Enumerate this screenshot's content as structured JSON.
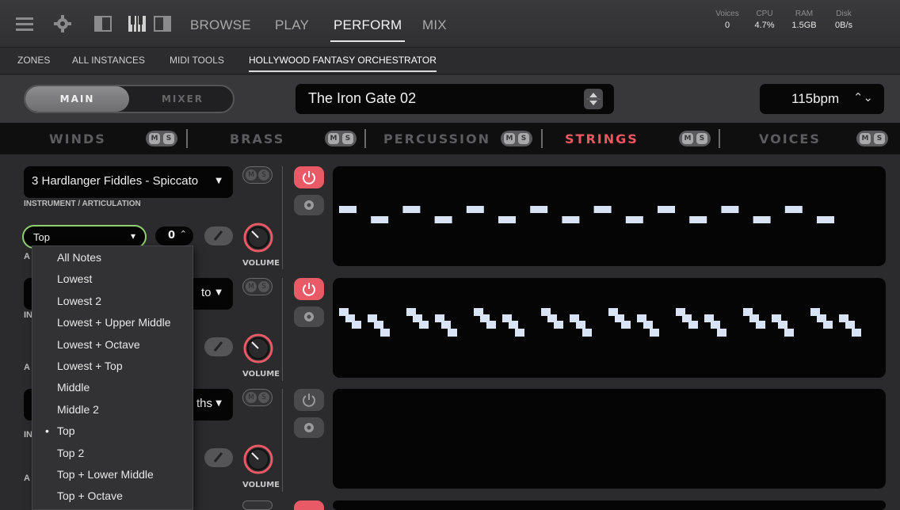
{
  "topbar": {
    "tabs": [
      {
        "label": "BROWSE",
        "active": false
      },
      {
        "label": "PLAY",
        "active": false
      },
      {
        "label": "PERFORM",
        "active": true
      },
      {
        "label": "MIX",
        "active": false
      }
    ],
    "icons": [
      "menu-icon",
      "gear-icon",
      "left-panel-icon",
      "keyboard-icon",
      "right-panel-icon"
    ],
    "stats": [
      {
        "label": "Voices",
        "value": "0"
      },
      {
        "label": "CPU",
        "value": "4.7%"
      },
      {
        "label": "RAM",
        "value": "1.5GB"
      },
      {
        "label": "Disk",
        "value": "0B/s"
      }
    ]
  },
  "subtabs": [
    {
      "label": "ZONES",
      "active": false
    },
    {
      "label": "ALL INSTANCES",
      "active": false
    },
    {
      "label": "MIDI TOOLS",
      "active": false
    },
    {
      "label": "HOLLYWOOD FANTASY ORCHESTRATOR",
      "active": true
    }
  ],
  "mode": {
    "main": "MAIN",
    "mixer": "MIXER",
    "selected": "MAIN"
  },
  "preset": {
    "name": "The Iron Gate 02"
  },
  "tempo": {
    "value": "115bpm"
  },
  "sections": [
    {
      "label": "WINDS",
      "active": false,
      "m": "M",
      "s": "S"
    },
    {
      "label": "BRASS",
      "active": false,
      "m": "M",
      "s": "S"
    },
    {
      "label": "PERCUSSION",
      "active": false,
      "m": "M",
      "s": "S"
    },
    {
      "label": "STRINGS",
      "active": true,
      "m": "M",
      "s": "S"
    },
    {
      "label": "VOICES",
      "active": false,
      "m": "M",
      "s": "S"
    }
  ],
  "rows": [
    {
      "instrument": "3 Hardlanger Fiddles - Spiccato",
      "instrument_label": "INSTRUMENT / ARTICULATION",
      "arp_value": "0",
      "volume_label": "VOLUME",
      "power": "on"
    },
    {
      "instrument_partial": "to",
      "arp_prefix": "A",
      "inst_prefix": "IN",
      "volume_label": "VOLUME",
      "power": "on"
    },
    {
      "instrument_partial": "ths",
      "arp_prefix": "A",
      "inst_prefix": "IN",
      "volume_label": "VOLUME",
      "power": "off"
    }
  ],
  "row1_labels": {
    "arp_prefix": "A"
  },
  "arp_select": {
    "value": "Top",
    "options": [
      "All Notes",
      "Lowest",
      "Lowest 2",
      "Lowest + Upper Middle",
      "Lowest + Octave",
      "Lowest + Top",
      "Middle",
      "Middle 2",
      "Top",
      "Top 2",
      "Top + Lower Middle",
      "Top + Octave"
    ],
    "selected_index": 8
  },
  "colors": {
    "accent_red": "#ef5560",
    "power_on": "#e85a66",
    "select_border": "#8fd170",
    "note": "#d8e4f6"
  }
}
